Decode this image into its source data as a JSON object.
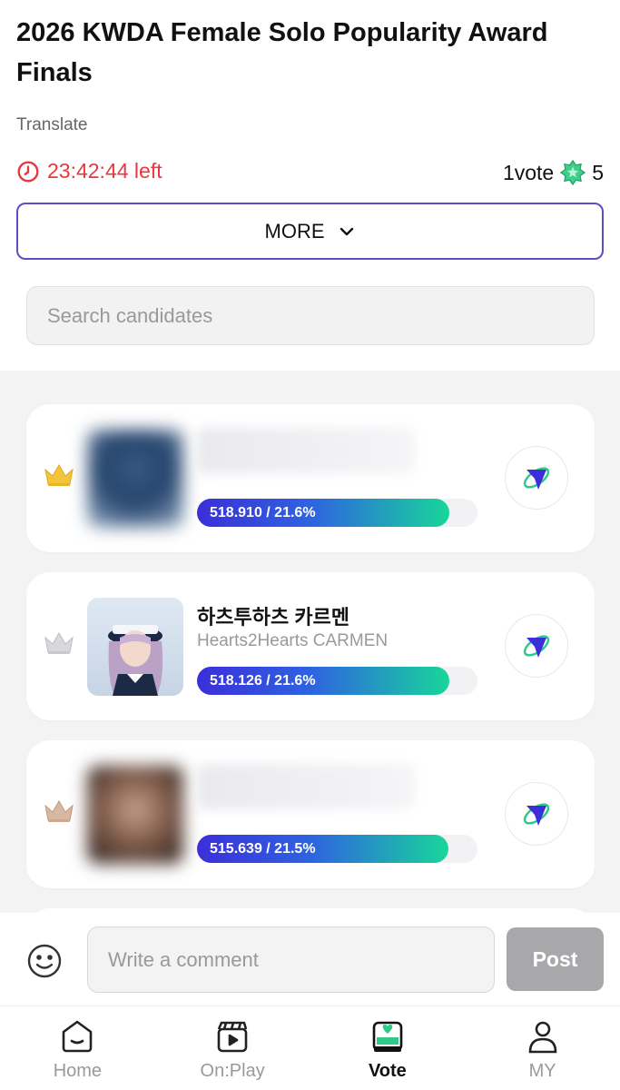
{
  "header": {
    "title": "2026 KWDA Female Solo Popularity Award Finals",
    "translate_label": "Translate",
    "time_left": "23:42:44 left",
    "vote_label": "1vote",
    "vote_cost": "5"
  },
  "more_button": {
    "label": "MORE"
  },
  "search": {
    "placeholder": "Search candidates"
  },
  "candidates": [
    {
      "rank": 1,
      "name": "",
      "sub": "",
      "bar_text": "518.910 / 21.6%",
      "percent": 21.6,
      "crown": "gold",
      "blurred": true
    },
    {
      "rank": 2,
      "name": "하츠투하츠 카르멘",
      "sub": "Hearts2Hearts CARMEN",
      "bar_text": "518.126 / 21.6%",
      "percent": 21.6,
      "crown": "silver",
      "blurred": false
    },
    {
      "rank": 3,
      "name": "",
      "sub": "",
      "bar_text": "515.639 / 21.5%",
      "percent": 21.5,
      "crown": "bronze",
      "blurred": true
    }
  ],
  "comment": {
    "placeholder": "Write a comment",
    "post_label": "Post"
  },
  "nav": {
    "items": [
      {
        "label": "Home",
        "icon": "home-icon",
        "active": false
      },
      {
        "label": "On:Play",
        "icon": "onplay-icon",
        "active": false
      },
      {
        "label": "Vote",
        "icon": "vote-icon",
        "active": true
      },
      {
        "label": "MY",
        "icon": "profile-icon",
        "active": false
      }
    ]
  },
  "colors": {
    "accent": "#5b4fc7",
    "timer": "#e8383d",
    "vote_green": "#2fc98a",
    "bar_start": "#3b2fd9",
    "bar_end": "#18d69a"
  }
}
